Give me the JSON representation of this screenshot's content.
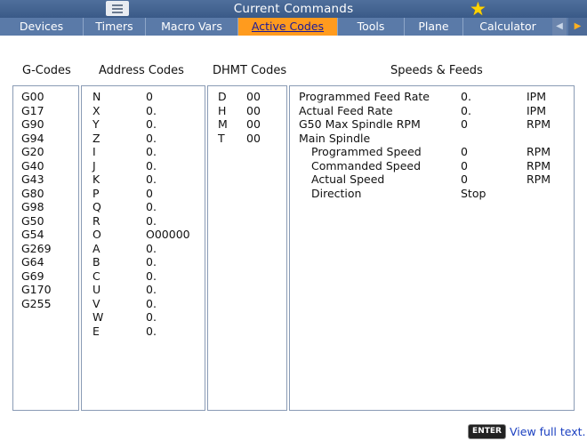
{
  "title": "Current Commands",
  "tabs": [
    {
      "label": "Devices"
    },
    {
      "label": "Timers"
    },
    {
      "label": "Macro Vars"
    },
    {
      "label": "Active Codes",
      "active": true
    },
    {
      "label": "Tools"
    },
    {
      "label": "Plane"
    },
    {
      "label": "Calculator"
    }
  ],
  "headers": {
    "g_codes": "G-Codes",
    "address_codes": "Address Codes",
    "dhmt_codes": "DHMT Codes",
    "speeds_feeds": "Speeds & Feeds"
  },
  "g_codes": [
    "G00",
    "G17",
    "G90",
    "G94",
    "G20",
    "G40",
    "G43",
    "G80",
    "G98",
    "G50",
    "G54",
    "G269",
    "G64",
    "G69",
    "G170",
    "G255"
  ],
  "address_codes": [
    {
      "letter": "N",
      "value": "0"
    },
    {
      "letter": "X",
      "value": "0."
    },
    {
      "letter": "Y",
      "value": "0."
    },
    {
      "letter": "Z",
      "value": "0."
    },
    {
      "letter": "I",
      "value": "0."
    },
    {
      "letter": "J",
      "value": "0."
    },
    {
      "letter": "K",
      "value": "0."
    },
    {
      "letter": "P",
      "value": "0"
    },
    {
      "letter": "Q",
      "value": "0."
    },
    {
      "letter": "R",
      "value": "0."
    },
    {
      "letter": "O",
      "value": "O00000"
    },
    {
      "letter": "A",
      "value": "0."
    },
    {
      "letter": "B",
      "value": "0."
    },
    {
      "letter": "C",
      "value": "0."
    },
    {
      "letter": "U",
      "value": "0."
    },
    {
      "letter": "V",
      "value": "0."
    },
    {
      "letter": "W",
      "value": "0."
    },
    {
      "letter": "E",
      "value": "0."
    }
  ],
  "dhmt_codes": [
    {
      "letter": "D",
      "value": "00"
    },
    {
      "letter": "H",
      "value": "00"
    },
    {
      "letter": "M",
      "value": "00"
    },
    {
      "letter": "T",
      "value": "00"
    }
  ],
  "speeds_feeds": [
    {
      "label": "Programmed Feed Rate",
      "value": "0.",
      "unit": "IPM",
      "indent": false
    },
    {
      "label": "Actual Feed Rate",
      "value": "0.",
      "unit": "IPM",
      "indent": false
    },
    {
      "label": "G50 Max Spindle RPM",
      "value": "0",
      "unit": "RPM",
      "indent": false
    },
    {
      "label": "Main Spindle",
      "value": "",
      "unit": "",
      "indent": false
    },
    {
      "label": "Programmed Speed",
      "value": "0",
      "unit": "RPM",
      "indent": true
    },
    {
      "label": "Commanded Speed",
      "value": "0",
      "unit": "RPM",
      "indent": true
    },
    {
      "label": "Actual Speed",
      "value": "0",
      "unit": "RPM",
      "indent": true
    },
    {
      "label": "Direction",
      "value": "Stop",
      "unit": "",
      "indent": true
    }
  ],
  "footer": {
    "enter_key": "ENTER",
    "view_full_text": "View full text."
  }
}
